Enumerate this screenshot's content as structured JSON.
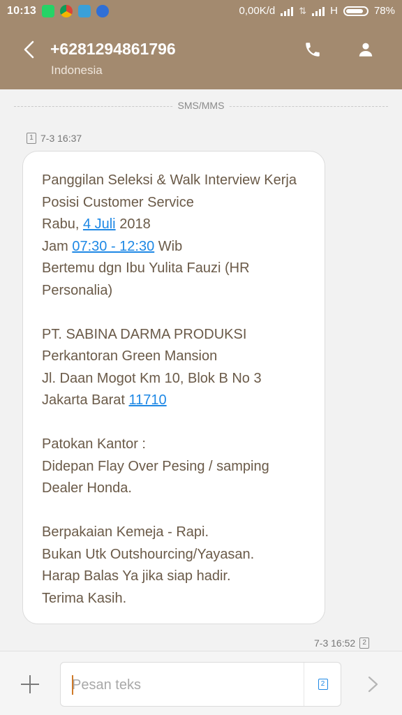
{
  "status_bar": {
    "time": "10:13",
    "speed": "0,00K/d",
    "network": "H",
    "battery": "78%"
  },
  "header": {
    "title": "+6281294861796",
    "subtitle": "Indonesia"
  },
  "thread": {
    "divider_label": "SMS/MMS",
    "incoming": {
      "sim": "1",
      "timestamp": "7-3 16:37"
    },
    "outgoing": {
      "timestamp": "7-3 16:52",
      "sim": "2"
    }
  },
  "message": {
    "l1": "Panggilan Seleksi & Walk Interview Kerja",
    "l2": "Posisi Customer Service",
    "l3_pre": "Rabu, ",
    "l3_link": "4 Juli",
    "l3_post": " 2018",
    "l4_pre": "Jam ",
    "l4_link": "07:30 - 12:30",
    "l4_post": " Wib",
    "l5": "Bertemu dgn Ibu Yulita Fauzi  (HR",
    "l6": "Personalia)",
    "l7": "PT. SABINA DARMA PRODUKSI",
    "l8": "Perkantoran Green Mansion",
    "l9": "Jl. Daan Mogot Km 10, Blok B No 3",
    "l10_pre": "Jakarta Barat ",
    "l10_link": "11710",
    "l11": "Patokan Kantor :",
    "l12": "Didepan Flay Over Pesing / samping",
    "l13": "Dealer Honda.",
    "l14": "Berpakaian Kemeja - Rapi.",
    "l15": "Bukan Utk Outshourcing/Yayasan.",
    "l16": "Harap Balas Ya jika siap hadir.",
    "l17": "Terima Kasih."
  },
  "composer": {
    "placeholder": "Pesan teks",
    "sim": "2"
  },
  "colors": {
    "header": "#a38a6f",
    "message_text": "#6a5a48",
    "link": "#1e88e5",
    "background": "#f2f2f2"
  },
  "icons": {
    "back": "chevron-left-icon",
    "call": "phone-icon",
    "contact": "person-icon",
    "attach": "plus-icon",
    "send": "chevron-right-icon"
  }
}
